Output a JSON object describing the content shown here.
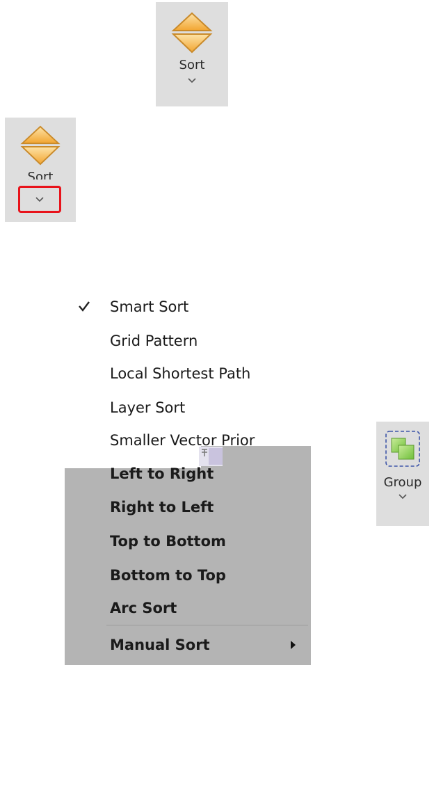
{
  "sort_button_top": {
    "label": "Sort",
    "icon": "sort-icon"
  },
  "sort_button_highlighted": {
    "label": "Sort",
    "icon": "sort-icon",
    "highlight_color": "#e8131b"
  },
  "sort_menu": {
    "items": [
      {
        "label": "Smart Sort",
        "checked": true
      },
      {
        "label": "Grid Pattern"
      },
      {
        "label": "Local Shortest Path"
      },
      {
        "label": "Layer Sort"
      },
      {
        "label": "Smaller Vector Prior"
      },
      {
        "label": "Left to Right"
      },
      {
        "label": "Right to Left"
      },
      {
        "label": "Top to Bottom"
      },
      {
        "label": "Bottom to Top"
      },
      {
        "label": "Arc Sort"
      },
      {
        "label": "Manual Sort",
        "has_submenu": true
      }
    ]
  },
  "group_button": {
    "label": "Group",
    "icon": "group-icon"
  },
  "colors": {
    "icon_orange": "#f5b349",
    "button_bg": "#dedede",
    "menu_panel_bg": "#b4b4b4"
  }
}
